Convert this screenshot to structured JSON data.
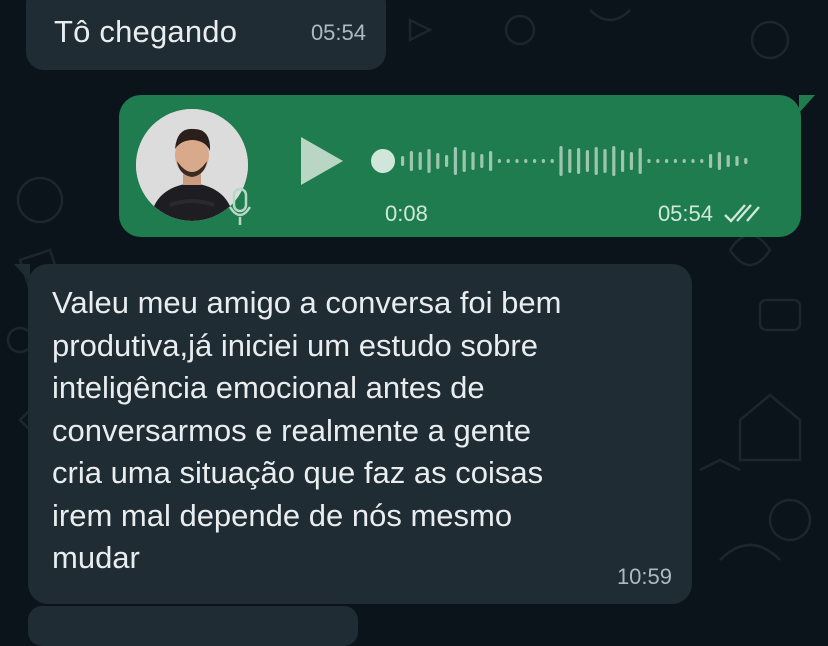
{
  "messages": [
    {
      "direction": "incoming",
      "text": "Tô chegando",
      "time": "05:54"
    },
    {
      "direction": "outgoing",
      "type": "voice",
      "duration": "0:08",
      "time": "05:54",
      "status_icon": "double-check-icon",
      "progress": 0
    },
    {
      "direction": "incoming",
      "text": "Valeu meu amigo a conversa foi bem\nprodutiva,já iniciei um estudo sobre\ninteligência emocional antes de\nconversarmos e realmente a gente\ncria uma situação que faz as coisas\nirem mal depende de nós mesmo\nmudar",
      "time": "10:59"
    }
  ],
  "colors": {
    "background": "#0b141a",
    "incoming_bubble": "#202c33",
    "outgoing_bubble": "#1f7c4f",
    "text": "#e9edef",
    "meta_text": "#aebac1"
  },
  "icons": {
    "play": "play-icon",
    "mic": "microphone-icon",
    "avatar": "avatar"
  }
}
